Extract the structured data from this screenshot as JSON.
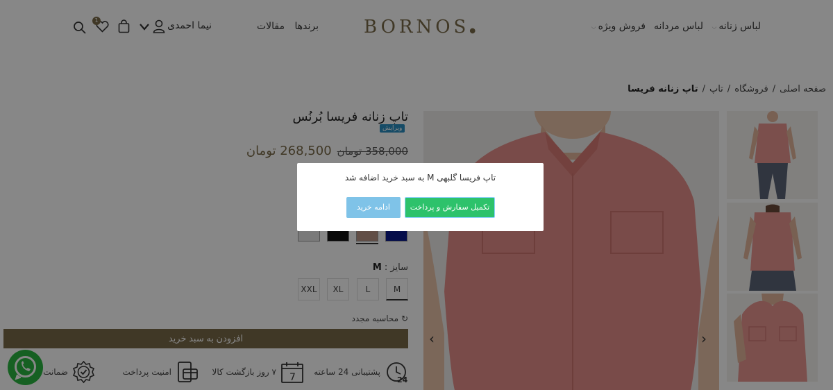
{
  "header": {
    "logo": "BORNOS",
    "nav": {
      "women": "لباس زنانه",
      "men": "لباس مردانه",
      "special": "فروش ویژه",
      "brands": "برندها",
      "articles": "مقالات"
    },
    "user_name": "نیما احمدی",
    "wishlist_count": "1"
  },
  "breadcrumb": {
    "home": "صفحه اصلی",
    "shop": "فروشگاه",
    "category": "تاپ",
    "current": "تاپ زنانه فریسا"
  },
  "product": {
    "title": "تاپ زنانه فریسا بُرنُس",
    "edit_label": "ویرایش",
    "old_price": "358,000 تومان",
    "new_price": "268,500 تومان",
    "swatches": [
      "#0a1a8c",
      "#b89384",
      "#111111",
      "#e6e6e6"
    ],
    "selected_swatch": 1,
    "size_label": "سایز :",
    "size_value": "M",
    "sizes": [
      "M",
      "L",
      "XL",
      "XXL"
    ],
    "recalc": "محاسبه مجدد",
    "add_to_cart": "افزودن به سبد خرید"
  },
  "features": {
    "support": "پشتیبانی 24 ساعته",
    "return": "۷ روز بازگشت کالا",
    "security": "امنیت پرداخت",
    "guarantee": "ضمانت"
  },
  "modal": {
    "message": "تاپ فریسا گلبهی M به سبد خرید اضافه شد",
    "checkout": "تکمیل سفارش و پرداخت",
    "continue": "ادامه خرید"
  },
  "colors": {
    "brand": "#7a6a48",
    "checkout_button": "#2dc26b",
    "continue_button": "#7fc3e8",
    "whatsapp": "#2ab540",
    "shirt": "#e58f8a"
  }
}
